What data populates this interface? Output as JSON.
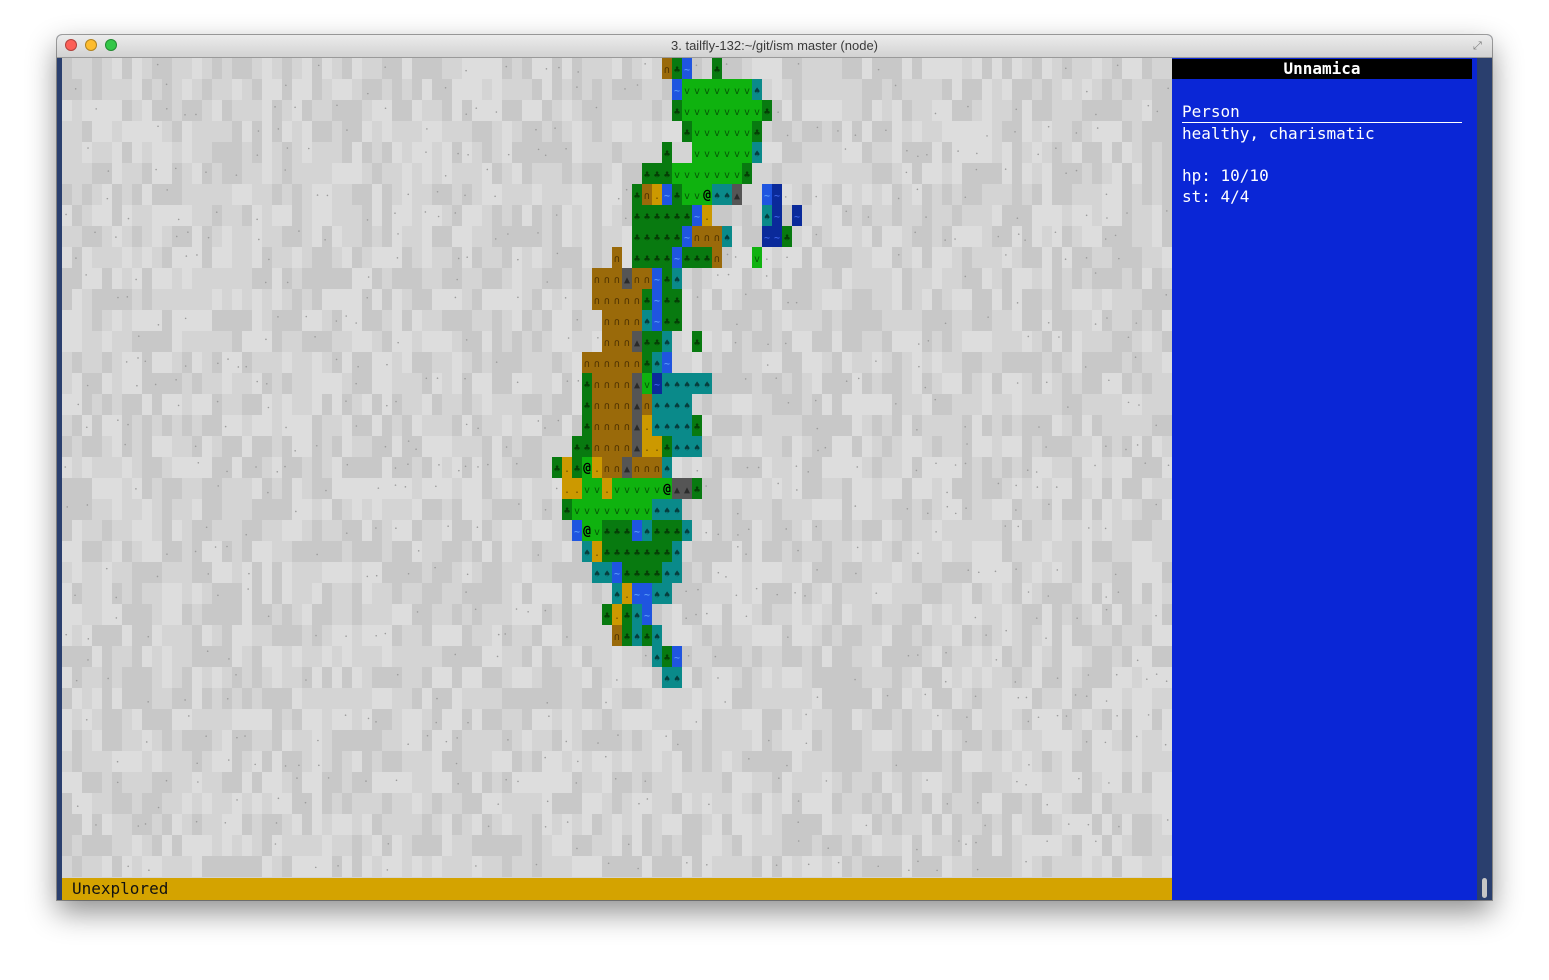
{
  "window": {
    "title": "3. tailfly-132:~/git/ism  master (node)",
    "fullscreen_icon": "expand-arrows-icon"
  },
  "sidebar": {
    "header": "Unnamica",
    "entity_kind": "Person",
    "traits": "healthy, charismatic",
    "hp": "hp: 10/10",
    "st": "st: 4/4"
  },
  "status": {
    "text": "Unexplored"
  },
  "map": {
    "colors": {
      "unexplored_a": "#d4d4d4",
      "unexplored_b": "#c8c8c8",
      "unexplored_c": "#dddddd",
      "grass": "#0fb20f",
      "forest": "#087a10",
      "teal": "#0a8a8a",
      "desert": "#cc9900",
      "hills": "#9a6a0a",
      "rock": "#555555",
      "water": "#1f55e0",
      "deep": "#0a2a9a",
      "sidebar": "#0a26d6",
      "status": "#d4a300"
    },
    "rows": [
      {
        "row": 0,
        "col": 60,
        "tiles": "hfw"
      },
      {
        "row": 0,
        "col": 65,
        "tiles": "f"
      },
      {
        "row": 1,
        "col": 61,
        "tiles": "wgggggggt"
      },
      {
        "row": 2,
        "col": 61,
        "tiles": "fggggggggf"
      },
      {
        "row": 3,
        "col": 62,
        "tiles": "fggggggf"
      },
      {
        "row": 4,
        "col": 60,
        "tiles": "f"
      },
      {
        "row": 4,
        "col": 63,
        "tiles": "ggggggt"
      },
      {
        "row": 5,
        "col": 58,
        "tiles": "fffgggggggf"
      },
      {
        "row": 6,
        "col": 57,
        "tiles": "fhdwfggTttr"
      },
      {
        "row": 7,
        "col": 57,
        "tiles": "ffffffwd"
      },
      {
        "row": 7,
        "col": 70,
        "tiles": "tk"
      },
      {
        "row": 8,
        "col": 57,
        "tiles": "fffffwhhht"
      },
      {
        "row": 8,
        "col": 70,
        "tiles": "kf"
      },
      {
        "row": 9,
        "col": 55,
        "tiles": "h"
      },
      {
        "row": 9,
        "col": 57,
        "tiles": "ffffwfffh"
      },
      {
        "row": 10,
        "col": 53,
        "tiles": "hhhrhhwft"
      },
      {
        "row": 11,
        "col": 53,
        "tiles": "hhhhhfwff"
      },
      {
        "row": 12,
        "col": 54,
        "tiles": "hhhhtwff"
      },
      {
        "row": 13,
        "col": 54,
        "tiles": "hhhrfft"
      },
      {
        "row": 13,
        "col": 63,
        "tiles": "f"
      },
      {
        "row": 14,
        "col": 52,
        "tiles": "hhhhhhftw"
      },
      {
        "row": 15,
        "col": 52,
        "tiles": "fhhhhrgkttttt"
      },
      {
        "row": 16,
        "col": 52,
        "tiles": "fhhhhrhtttt"
      },
      {
        "row": 17,
        "col": 52,
        "tiles": "fhhhhrdttttf"
      },
      {
        "row": 18,
        "col": 51,
        "tiles": "ffhhhhrddfttt"
      },
      {
        "row": 19,
        "col": 49,
        "tiles": "fdfTdhhrhhht"
      },
      {
        "row": 20,
        "col": 50,
        "tiles": "ddggdgggggTrrf"
      },
      {
        "row": 21,
        "col": 50,
        "tiles": "fggggggggttt"
      },
      {
        "row": 22,
        "col": 51,
        "tiles": "wTgfffwtffft"
      },
      {
        "row": 23,
        "col": 52,
        "tiles": "tdffffffft"
      },
      {
        "row": 24,
        "col": 53,
        "tiles": "ttwfffftt"
      },
      {
        "row": 25,
        "col": 55,
        "tiles": "tdwwtt"
      },
      {
        "row": 26,
        "col": 54,
        "tiles": "fdftw"
      },
      {
        "row": 27,
        "col": 55,
        "tiles": "hftft"
      },
      {
        "row": 28,
        "col": 59,
        "tiles": "tfw"
      },
      {
        "row": 29,
        "col": 60,
        "tiles": "tt"
      }
    ],
    "extra": [
      {
        "row": 9,
        "col": 69,
        "tiles": "g"
      },
      {
        "row": 6,
        "col": 70,
        "tiles": "wk"
      },
      {
        "row": 7,
        "col": 73,
        "tiles": "k"
      },
      {
        "row": 8,
        "col": 71,
        "tiles": "kf"
      }
    ]
  }
}
